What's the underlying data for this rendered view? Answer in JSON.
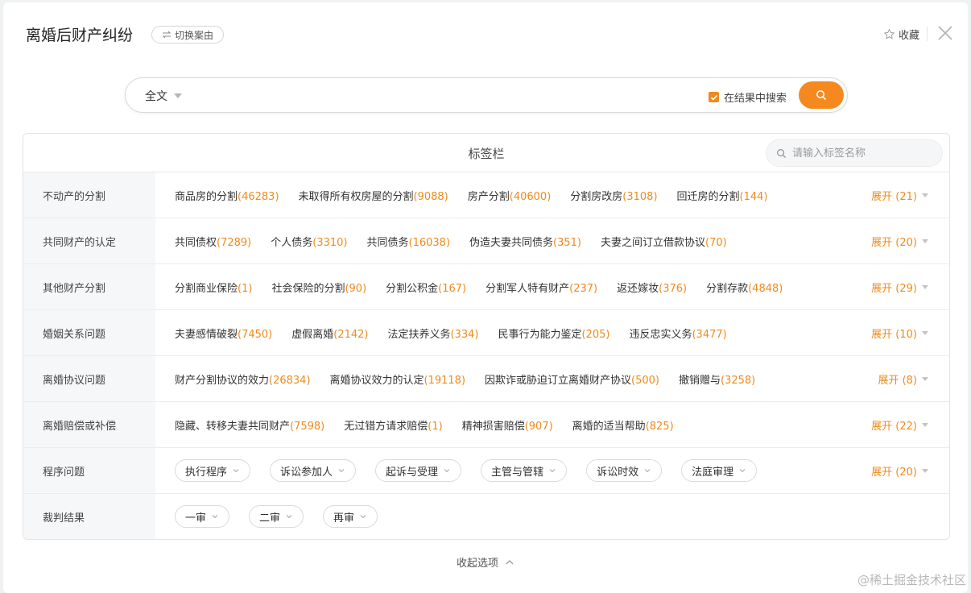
{
  "header": {
    "title": "离婚后财产纠纷",
    "switch_label": "切换案由",
    "favorite_label": "收藏"
  },
  "search": {
    "scope": "全文",
    "placeholder": "",
    "in_result_label": "在结果中搜索",
    "in_result_checked": true
  },
  "tags_panel": {
    "title": "标签栏",
    "search_placeholder": "请输入标签名称",
    "rows": [
      {
        "label": "不动产的分割",
        "items": [
          {
            "name": "商品房的分割",
            "count": "(46283)"
          },
          {
            "name": "未取得所有权房屋的分割",
            "count": "(9088)"
          },
          {
            "name": "房产分割",
            "count": "(40600)"
          },
          {
            "name": "分割房改房",
            "count": "(3108)"
          },
          {
            "name": "回迁房的分割",
            "count": "(144)"
          }
        ],
        "expand": "展开 (21)"
      },
      {
        "label": "共同财产的认定",
        "items": [
          {
            "name": "共同债权",
            "count": "(7289)"
          },
          {
            "name": "个人债务",
            "count": "(3310)"
          },
          {
            "name": "共同债务",
            "count": "(16038)"
          },
          {
            "name": "伪造夫妻共同债务",
            "count": "(351)"
          },
          {
            "name": "夫妻之间订立借款协议",
            "count": "(70)"
          }
        ],
        "expand": "展开 (20)"
      },
      {
        "label": "其他财产分割",
        "items": [
          {
            "name": "分割商业保险",
            "count": "(1)"
          },
          {
            "name": "社会保险的分割",
            "count": "(90)"
          },
          {
            "name": "分割公积金",
            "count": "(167)"
          },
          {
            "name": "分割军人特有财产",
            "count": "(237)"
          },
          {
            "name": "返还嫁妆",
            "count": "(376)"
          },
          {
            "name": "分割存款",
            "count": "(4848)"
          }
        ],
        "expand": "展开 (29)"
      },
      {
        "label": "婚姻关系问题",
        "items": [
          {
            "name": "夫妻感情破裂",
            "count": "(7450)"
          },
          {
            "name": "虚假离婚",
            "count": "(2142)"
          },
          {
            "name": "法定扶养义务",
            "count": "(334)"
          },
          {
            "name": "民事行为能力鉴定",
            "count": "(205)"
          },
          {
            "name": "违反忠实义务",
            "count": "(3477)"
          }
        ],
        "expand": "展开 (10)"
      },
      {
        "label": "离婚协议问题",
        "items": [
          {
            "name": "财产分割协议的效力",
            "count": "(26834)"
          },
          {
            "name": "离婚协议效力的认定",
            "count": "(19118)"
          },
          {
            "name": "因欺诈或胁迫订立离婚财产协议",
            "count": "(500)"
          },
          {
            "name": "撤销赠与",
            "count": "(3258)"
          }
        ],
        "expand": "展开 (8)"
      },
      {
        "label": "离婚赔偿或补偿",
        "items": [
          {
            "name": "隐藏、转移夫妻共同财产",
            "count": "(7598)"
          },
          {
            "name": "无过错方请求赔偿",
            "count": "(1)"
          },
          {
            "name": "精神损害赔偿",
            "count": "(907)"
          },
          {
            "name": "离婚的适当帮助",
            "count": "(825)"
          }
        ],
        "expand": "展开 (22)"
      }
    ],
    "procedure": {
      "label": "程序问题",
      "pills": [
        "执行程序",
        "诉讼参加人",
        "起诉与受理",
        "主管与管辖",
        "诉讼时效",
        "法庭审理"
      ],
      "expand": "展开 (20)"
    },
    "judgment": {
      "label": "裁判结果",
      "pills": [
        "一审",
        "二审",
        "再审"
      ]
    }
  },
  "footer": {
    "collapse_label": "收起选项",
    "watermark": "@稀土掘金技术社区"
  },
  "colors": {
    "accent": "#f08a1c",
    "search_button": "#f5891f"
  }
}
